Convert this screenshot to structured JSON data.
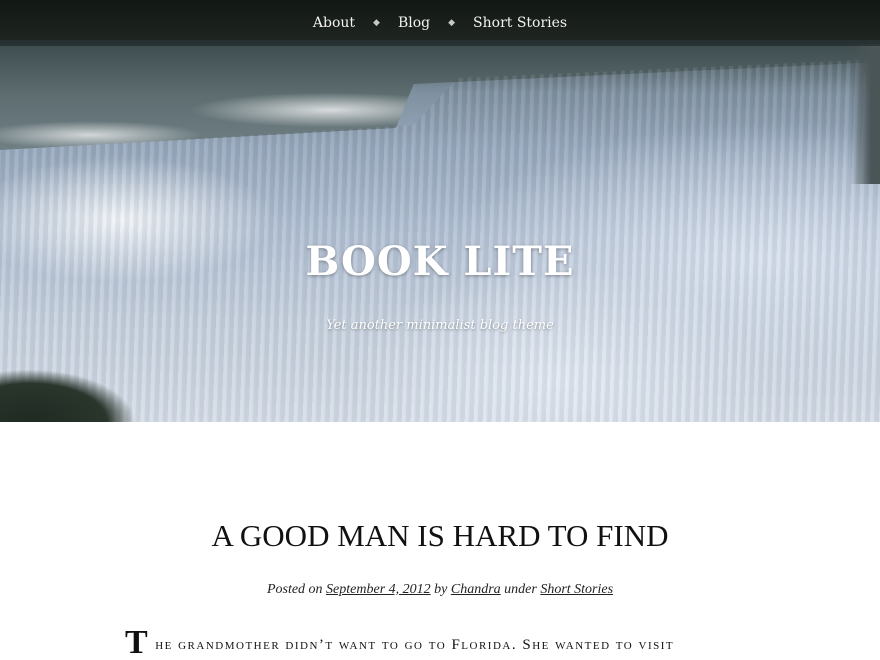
{
  "nav": {
    "items": [
      {
        "label": "About"
      },
      {
        "label": "Blog"
      },
      {
        "label": "Short Stories"
      }
    ],
    "separator": "◆"
  },
  "site": {
    "title": "BOOK LITE",
    "tagline": "Yet another minimalist blog theme"
  },
  "post": {
    "title": "A GOOD MAN IS HARD TO FIND",
    "meta": {
      "posted_on": "Posted on",
      "date": "September 4, 2012",
      "by": "by",
      "author": "Chandra",
      "under": "under",
      "category": "Short Stories"
    },
    "body": {
      "dropcap": "T",
      "first_line": "he grandmother didn’t want to go to Florida. She wanted to visit"
    }
  }
}
